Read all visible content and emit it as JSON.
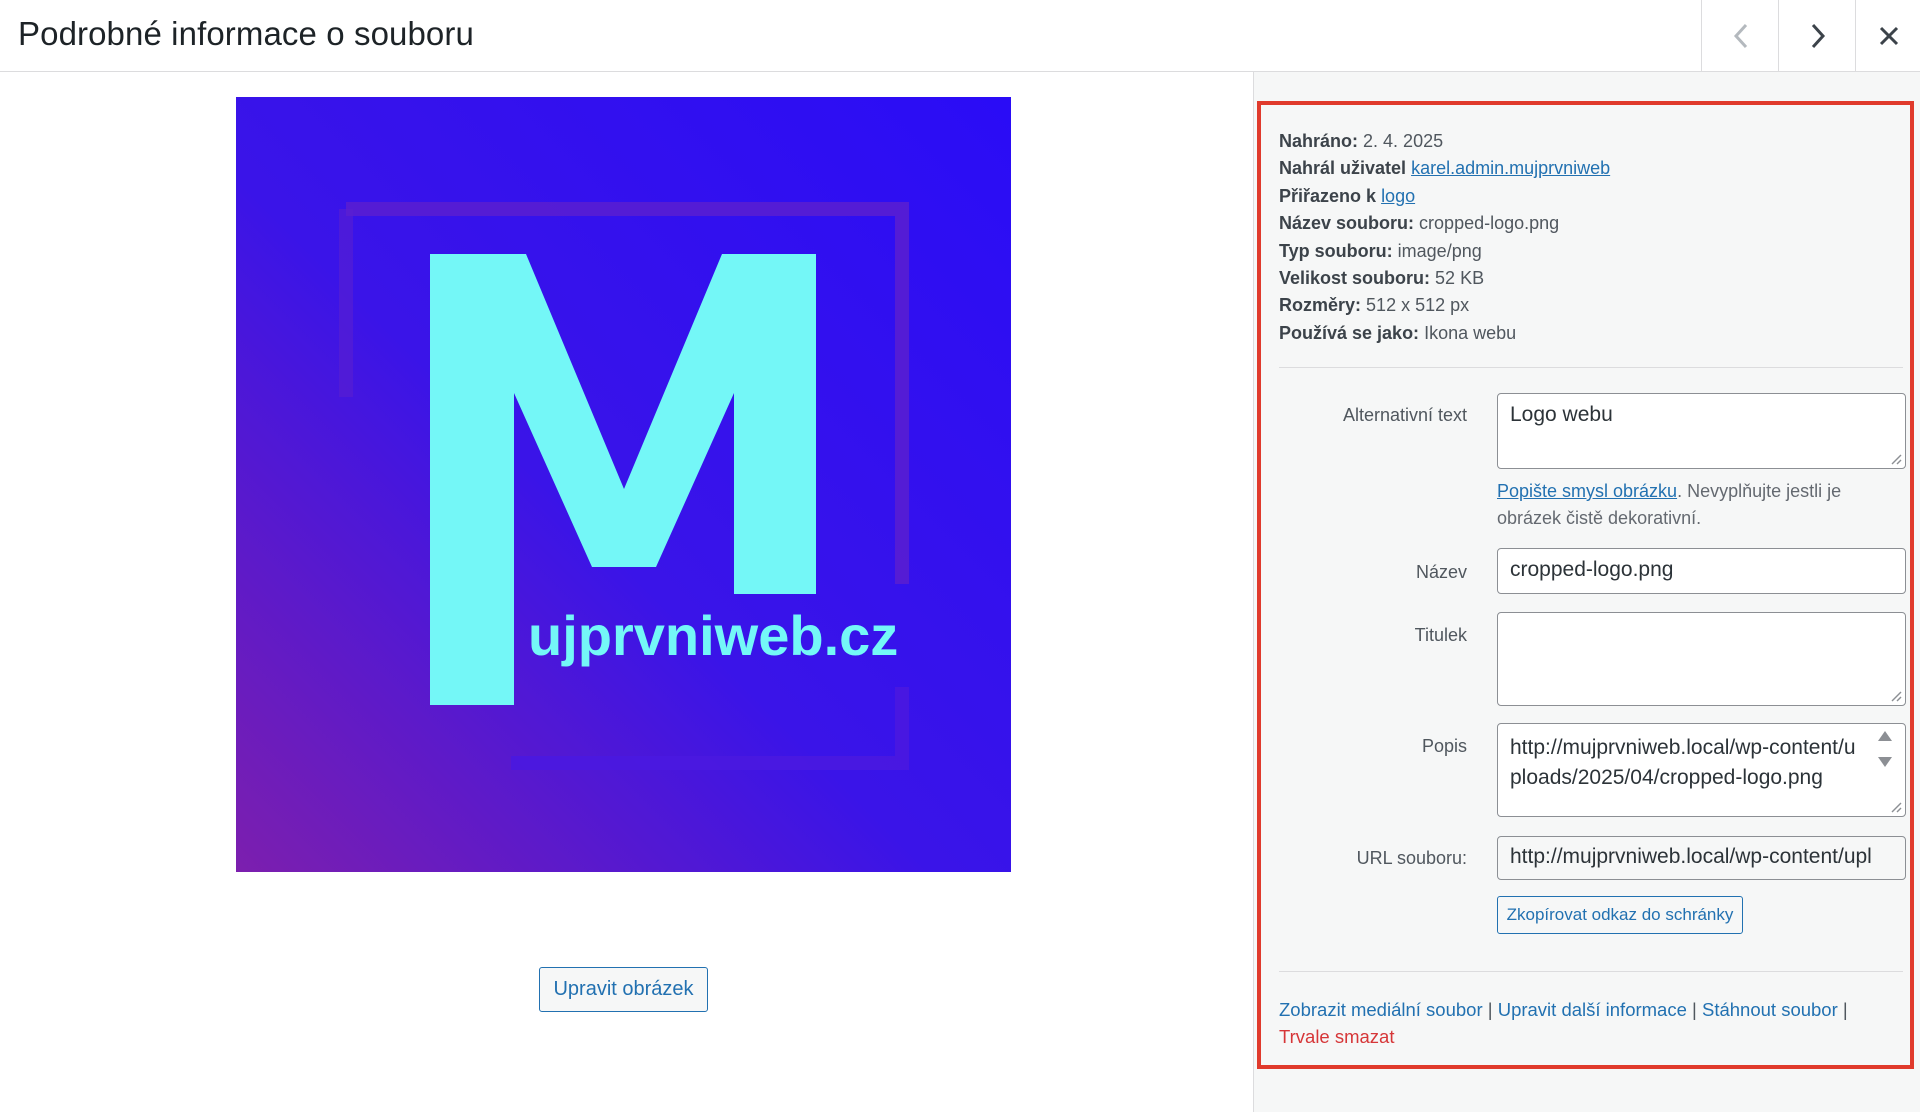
{
  "header": {
    "title": "Podrobné informace o souboru"
  },
  "preview": {
    "logo_text": "ujprvniweb.cz",
    "colors": {
      "bg_top": "#2d0df5",
      "bg_bottom": "#7a1fb0",
      "logo": "#74f7f7",
      "frame": "#5b1ecf"
    },
    "edit_button": "Upravit obrázek"
  },
  "meta": {
    "uploaded_label": "Nahráno:",
    "uploaded_value": "2. 4. 2025",
    "uploaded_by_label": "Nahrál uživatel",
    "uploaded_by_value": "karel.admin.mujprvniweb",
    "attached_label": "Přiřazeno k",
    "attached_value": "logo",
    "filename_label": "Název souboru:",
    "filename_value": "cropped-logo.png",
    "filetype_label": "Typ souboru:",
    "filetype_value": "image/png",
    "filesize_label": "Velikost souboru:",
    "filesize_value": "52 KB",
    "dimensions_label": "Rozměry:",
    "dimensions_value": "512 x 512 px",
    "used_as_label": "Používá se jako:",
    "used_as_value": "Ikona webu"
  },
  "form": {
    "alt_label": "Alternativní text",
    "alt_value": "Logo webu",
    "alt_help_link": "Popište smysl obrázku",
    "alt_help_text": ". Nevyplňujte jestli je obrázek čistě dekorativní.",
    "title_label": "Název",
    "title_value": "cropped-logo.png",
    "caption_label": "Titulek",
    "caption_value": "",
    "description_label": "Popis",
    "description_value": "http://mujprvniweb.local/wp-content/uploads/2025/04/cropped-logo.png",
    "url_label": "URL souboru:",
    "url_value": "http://mujprvniweb.local/wp-content/upl",
    "copy_button": "Zkopírovat odkaz do schránky"
  },
  "actions": {
    "view": "Zobrazit mediální soubor",
    "edit_more": "Upravit další informace",
    "download": "Stáhnout soubor",
    "delete": "Trvale smazat",
    "separator": "|"
  },
  "accent_color": "#2271b1",
  "highlight_color": "#e03a2c"
}
